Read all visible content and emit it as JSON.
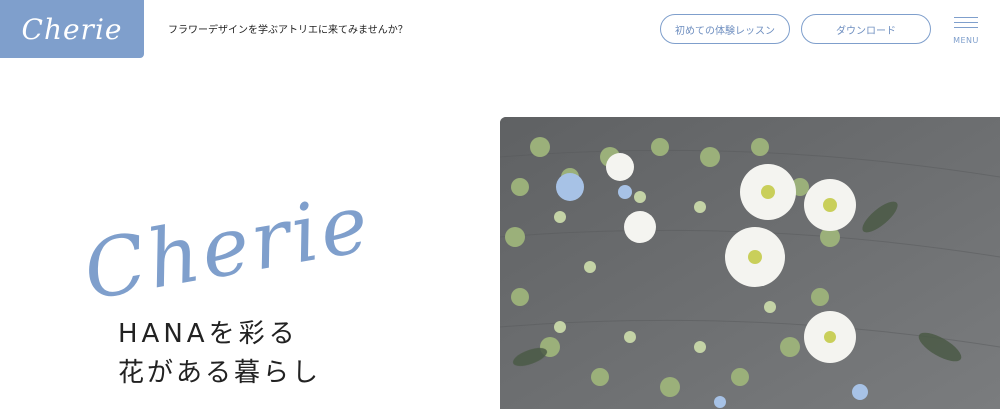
{
  "header": {
    "logo_text": "Cherie",
    "tagline": "フラワーデザインを学ぶアトリエに来てみませんか？",
    "trial_button_label": "初めての体験レッスン",
    "download_button_label": "ダウンロード",
    "menu_label": "MENU"
  },
  "hero": {
    "script_title": "Cherie",
    "line1": "HANAを彩る",
    "line2": "花がある暮らし",
    "image_icon": "flower-wreath-photo"
  },
  "colors": {
    "brand": "#7f9fcc",
    "text": "#222222",
    "background": "#ffffff"
  }
}
